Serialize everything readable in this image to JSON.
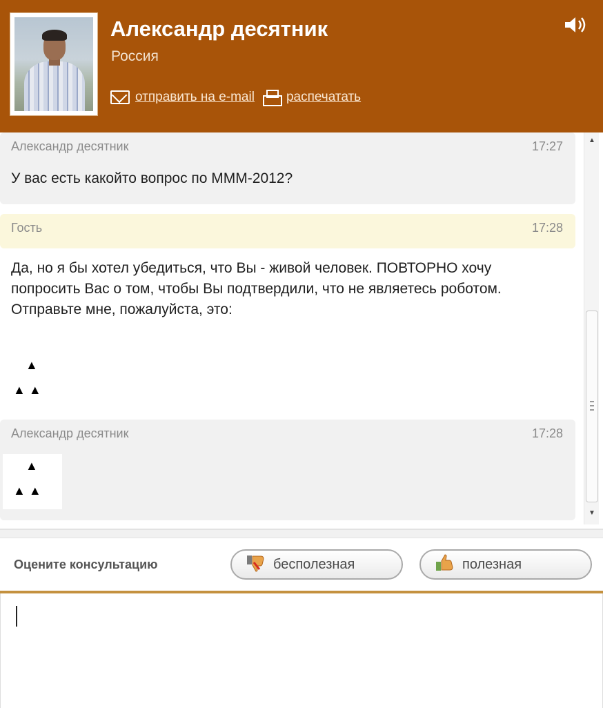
{
  "header": {
    "user_name": "Александр десятник",
    "country": "Россия",
    "email_action": "отправить на e-mail",
    "print_action": "распечатать"
  },
  "messages": [
    {
      "author": "Александр десятник",
      "time": "17:27",
      "text": "У вас есть какойто вопрос по МММ-2012?"
    },
    {
      "author": "Гость",
      "time": "17:28",
      "text": "Да, но я бы хотел убедиться, что Вы - живой человек. ПОВТОРНО хочу попросить Вас о том, чтобы Вы подтвердили, что не являетесь роботом. Отправьте мне, пожалуйста, это:",
      "symbols": [
        "▲",
        "▲ ▲"
      ]
    },
    {
      "author": "Александр десятник",
      "time": "17:28",
      "symbols": [
        "▲",
        "▲ ▲"
      ]
    }
  ],
  "rating": {
    "label": "Оцените консультацию",
    "bad_label": "бесполезная",
    "good_label": "полезная"
  },
  "icons": {
    "sound": "speaker-icon",
    "mail": "mail-icon",
    "print": "printer-icon",
    "thumb_down": "thumbs-down-icon",
    "thumb_up": "thumbs-up-icon"
  },
  "colors": {
    "header_bg": "#a85409",
    "guest_bg": "#fbf7dc",
    "bubble_bg": "#f1f1f1",
    "accent_rule": "#c4913f"
  }
}
